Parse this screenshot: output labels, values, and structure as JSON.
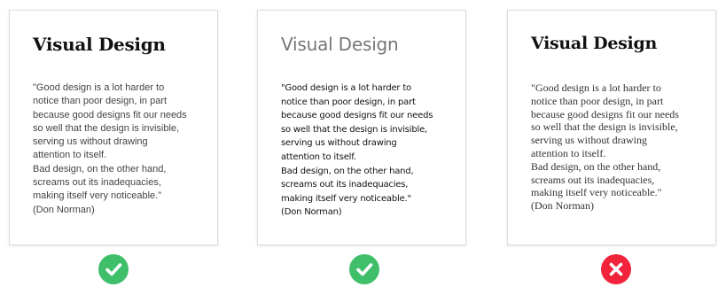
{
  "colors": {
    "good": "#3fbf6a",
    "bad": "#f0233a"
  },
  "cards": [
    {
      "title": "Visual Design",
      "quote": "\"Good design is a lot harder to\nnotice than poor design, in part\nbecause good designs fit our needs\nso well that the design is invisible,\nserving us without drawing\nattention to itself.\nBad design, on the other hand,\nscreams out its inadequacies,\nmaking itself very noticeable.\"\n(Don Norman)",
      "verdict_icon": "check-icon"
    },
    {
      "title": "Visual Design",
      "quote": "\"Good design is a lot harder to\nnotice than poor design, in part\nbecause good designs fit our needs\nso well that the design is invisible,\nserving us without drawing\nattention to itself.\nBad design, on the other hand,\nscreams out its inadequacies,\nmaking itself very noticeable.\"\n(Don Norman)",
      "verdict_icon": "check-icon"
    },
    {
      "title": "Visual Design",
      "quote": "\"Good design is a lot harder to\nnotice than poor design, in part\nbecause good designs fit our needs\nso well that the design is invisible,\nserving us without drawing\nattention to itself.\nBad design, on the other hand,\nscreams out its inadequacies,\nmaking itself very noticeable.\"\n(Don Norman)",
      "verdict_icon": "cross-icon"
    }
  ]
}
